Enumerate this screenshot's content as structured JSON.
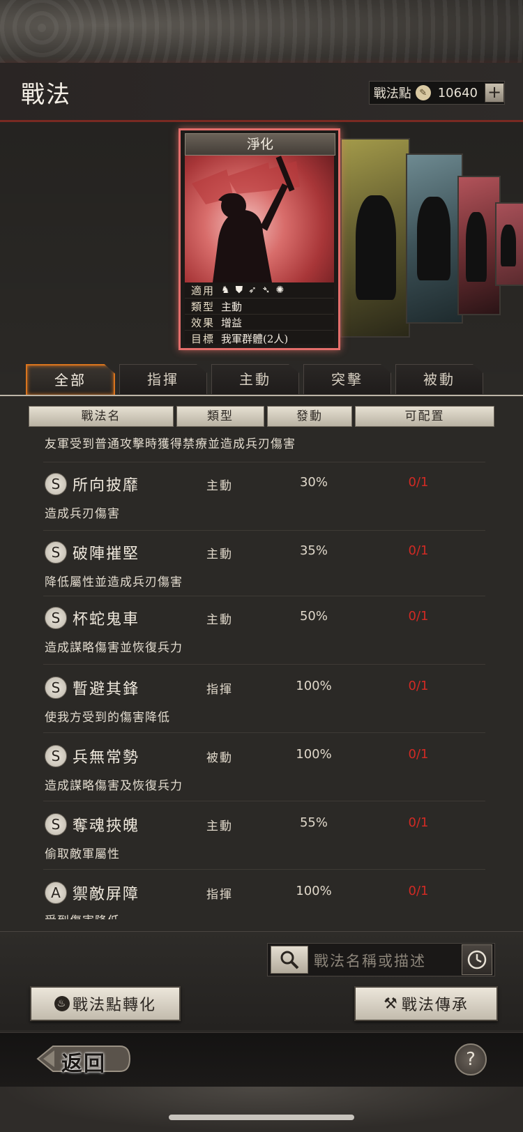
{
  "header": {
    "title": "戰法",
    "points_label": "戰法點",
    "points_value": "10640",
    "plus_label": "+"
  },
  "card": {
    "name": "淨化",
    "info": [
      {
        "key": "適用",
        "value": ""
      },
      {
        "key": "類型",
        "value": "主動"
      },
      {
        "key": "效果",
        "value": "增益"
      },
      {
        "key": "目標",
        "value": "我軍群體(2人)"
      }
    ],
    "fit_icons": [
      "cavalry-icon",
      "shield-icon",
      "bow-icon",
      "spear-icon",
      "chariot-icon"
    ]
  },
  "tabs": [
    "全部",
    "指揮",
    "主動",
    "突擊",
    "被動"
  ],
  "active_tab": 0,
  "columns": [
    "戰法名",
    "類型",
    "發動",
    "可配置"
  ],
  "list": {
    "top_desc": "友軍受到普通攻擊時獲得禁療並造成兵刃傷害",
    "items": [
      {
        "grade": "S",
        "name": "所向披靡",
        "type": "主動",
        "rate": "30%",
        "config": "0/1",
        "desc": "造成兵刃傷害"
      },
      {
        "grade": "S",
        "name": "破陣摧堅",
        "type": "主動",
        "rate": "35%",
        "config": "0/1",
        "desc": "降低屬性並造成兵刃傷害"
      },
      {
        "grade": "S",
        "name": "杯蛇鬼車",
        "type": "主動",
        "rate": "50%",
        "config": "0/1",
        "desc": "造成謀略傷害並恢復兵力"
      },
      {
        "grade": "S",
        "name": "暫避其鋒",
        "type": "指揮",
        "rate": "100%",
        "config": "0/1",
        "desc": "使我方受到的傷害降低"
      },
      {
        "grade": "S",
        "name": "兵無常勢",
        "type": "被動",
        "rate": "100%",
        "config": "0/1",
        "desc": "造成謀略傷害及恢復兵力"
      },
      {
        "grade": "S",
        "name": "奪魂挾魄",
        "type": "主動",
        "rate": "55%",
        "config": "0/1",
        "desc": "偷取敵軍屬性"
      },
      {
        "grade": "A",
        "name": "禦敵屏障",
        "type": "指揮",
        "rate": "100%",
        "config": "0/1",
        "desc": "受到傷害降低"
      }
    ]
  },
  "search": {
    "placeholder": "戰法名稱或描述"
  },
  "buttons": {
    "convert": "戰法點轉化",
    "inherit": "戰法傳承",
    "back": "返回",
    "help": "?"
  },
  "colors": {
    "accent": "#d9741e",
    "config_red": "#d12a24",
    "card_border": "#e36e6b"
  }
}
